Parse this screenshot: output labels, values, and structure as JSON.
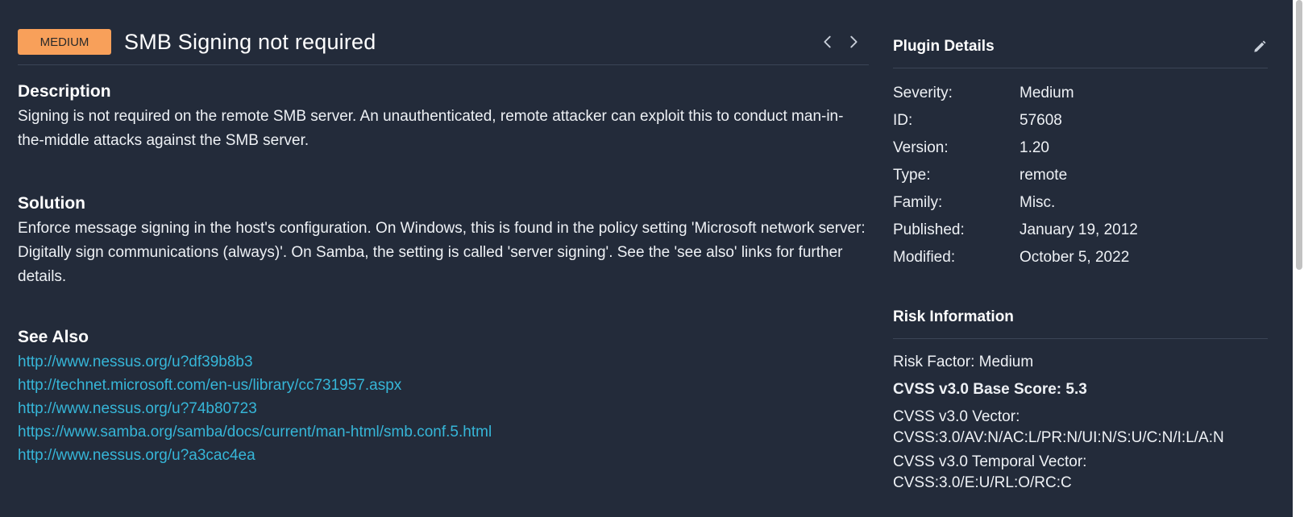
{
  "header": {
    "severity_badge": "MEDIUM",
    "title": "SMB Signing not required",
    "prev_icon": "chevron-left-icon",
    "next_icon": "chevron-right-icon"
  },
  "description": {
    "heading": "Description",
    "text": "Signing is not required on the remote SMB server. An unauthenticated, remote attacker can exploit this to conduct man-in-the-middle attacks against the SMB server."
  },
  "solution": {
    "heading": "Solution",
    "text": "Enforce message signing in the host's configuration. On Windows, this is found in the policy setting 'Microsoft network server: Digitally sign communications (always)'. On Samba, the setting is called 'server signing'. See the 'see also' links for further details."
  },
  "see_also": {
    "heading": "See Also",
    "links": [
      "http://www.nessus.org/u?df39b8b3",
      "http://technet.microsoft.com/en-us/library/cc731957.aspx",
      "http://www.nessus.org/u?74b80723",
      "https://www.samba.org/samba/docs/current/man-html/smb.conf.5.html",
      "http://www.nessus.org/u?a3cac4ea"
    ]
  },
  "plugin_details": {
    "heading": "Plugin Details",
    "edit_icon": "pencil-icon",
    "rows": [
      {
        "label": "Severity:",
        "value": "Medium"
      },
      {
        "label": "ID:",
        "value": "57608"
      },
      {
        "label": "Version:",
        "value": "1.20"
      },
      {
        "label": "Type:",
        "value": "remote"
      },
      {
        "label": "Family:",
        "value": "Misc."
      },
      {
        "label": "Published:",
        "value": "January 19, 2012"
      },
      {
        "label": "Modified:",
        "value": "October 5, 2022"
      }
    ]
  },
  "risk_information": {
    "heading": "Risk Information",
    "risk_factor": "Risk Factor: Medium",
    "cvss_base_score": "CVSS v3.0 Base Score: 5.3",
    "cvss_vector_label": "CVSS v3.0 Vector:",
    "cvss_vector": "CVSS:3.0/AV:N/AC:L/PR:N/UI:N/S:U/C:N/I:L/A:N",
    "cvss_temporal_label": "CVSS v3.0 Temporal Vector:",
    "cvss_temporal": "CVSS:3.0/E:U/RL:O/RC:C"
  },
  "colors": {
    "background": "#232b3a",
    "badge": "#f8a05a",
    "link": "#36b6d8"
  }
}
